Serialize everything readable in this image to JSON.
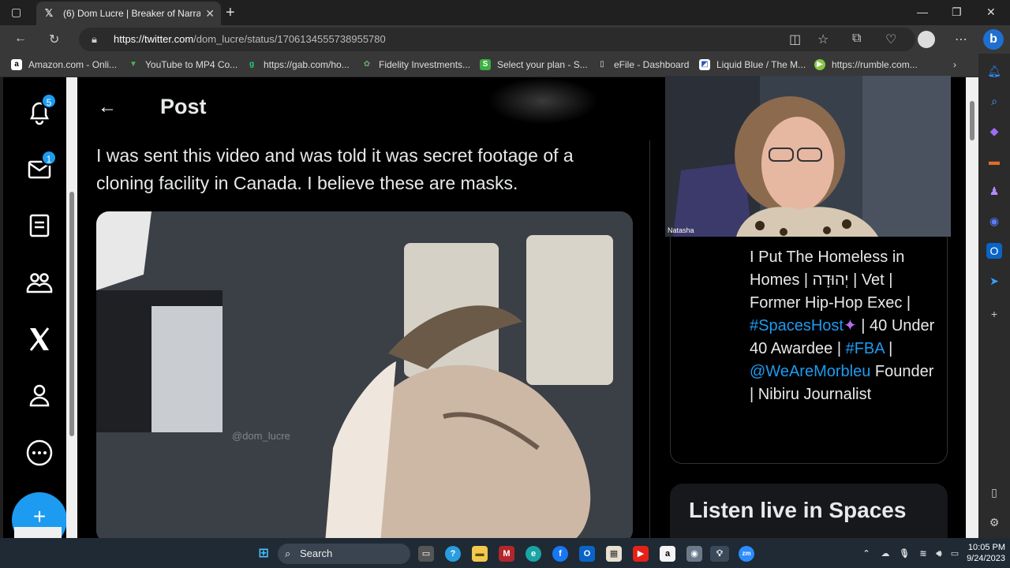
{
  "browser": {
    "tab_title": "(6) Dom Lucre | Breaker of Narrat",
    "tab_close": "✕",
    "new_tab": "+",
    "url_host": "https://twitter.com",
    "url_path": "/dom_lucre/status/1706134555738955780",
    "window_controls": [
      "—",
      "❐",
      "✕"
    ]
  },
  "bookmarks": [
    {
      "label": "Amazon.com - Onli...",
      "icon": "a",
      "color": "#ffffff"
    },
    {
      "label": "YouTube to MP4 Co...",
      "icon": "▼",
      "color": "#4caf50"
    },
    {
      "label": "https://gab.com/ho...",
      "icon": "g",
      "color": "#21cf7a"
    },
    {
      "label": "Fidelity Investments...",
      "icon": "✿",
      "color": "#3f7a3f"
    },
    {
      "label": "Select your plan - S...",
      "icon": "S",
      "color": "#3cb043"
    },
    {
      "label": "eFile - Dashboard",
      "icon": "▯",
      "color": "#555555"
    },
    {
      "label": "Liquid Blue / The M...",
      "icon": "◩",
      "color": "#ffffff"
    },
    {
      "label": "https://rumble.com...",
      "icon": "▶",
      "color": "#85c742"
    }
  ],
  "leftnav": {
    "notifications_badge": "5",
    "messages_badge": "1",
    "compose_icon": "+"
  },
  "post": {
    "header_title": "Post",
    "back_arrow": "←",
    "text": "I was sent this video and was told it was secret footage of a cloning facility in Canada. I believe these are masks.",
    "video_watermark": "@dom_lucre"
  },
  "right": {
    "bio_plain_1": "I Put The Homeless in Homes | יְהוּדָה | Vet | Former Hip-Hop Exec | ",
    "bio_link_1": "#SpacesHost",
    "bio_plain_2": " | 40 Under 40 Awardee | ",
    "bio_link_2": "#FBA",
    "bio_plain_3": " | ",
    "bio_link_3": "@WeAreMorbleu",
    "bio_plain_4": " Founder | Nibiru Journalist",
    "spaces_title": "Listen live in Spaces"
  },
  "webcam": {
    "name": "Natasha"
  },
  "taskbar": {
    "search_label": "Search",
    "time": "10:05 PM",
    "date": "9/24/2023"
  }
}
